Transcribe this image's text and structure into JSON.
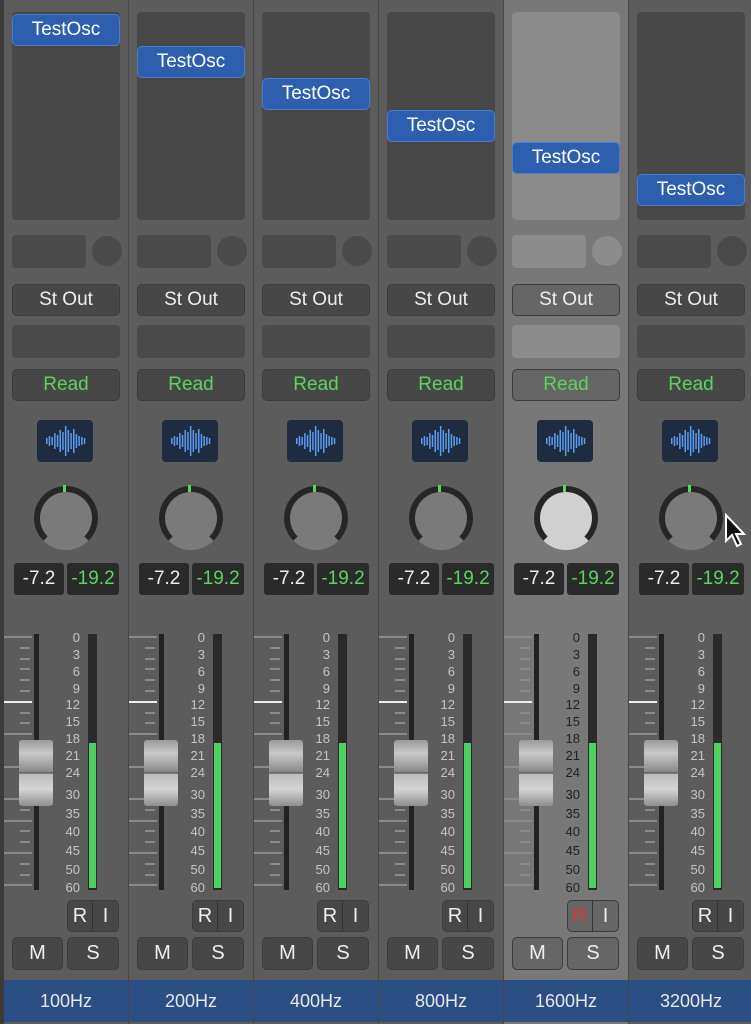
{
  "strips": [
    {
      "insert": "TestOsc",
      "output": "St Out",
      "automation": "Read",
      "volume": "-7.2",
      "peak": "-19.2",
      "record": "R",
      "input": "I",
      "mute": "M",
      "solo": "S",
      "name": "100Hz",
      "selected": false,
      "meter_db": -19.2
    },
    {
      "insert": "TestOsc",
      "output": "St Out",
      "automation": "Read",
      "volume": "-7.2",
      "peak": "-19.2",
      "record": "R",
      "input": "I",
      "mute": "M",
      "solo": "S",
      "name": "200Hz",
      "selected": false,
      "meter_db": -19.2
    },
    {
      "insert": "TestOsc",
      "output": "St Out",
      "automation": "Read",
      "volume": "-7.2",
      "peak": "-19.2",
      "record": "R",
      "input": "I",
      "mute": "M",
      "solo": "S",
      "name": "400Hz",
      "selected": false,
      "meter_db": -19.2
    },
    {
      "insert": "TestOsc",
      "output": "St Out",
      "automation": "Read",
      "volume": "-7.2",
      "peak": "-19.2",
      "record": "R",
      "input": "I",
      "mute": "M",
      "solo": "S",
      "name": "800Hz",
      "selected": false,
      "meter_db": -19.2
    },
    {
      "insert": "TestOsc",
      "output": "St Out",
      "automation": "Read",
      "volume": "-7.2",
      "peak": "-19.2",
      "record": "R",
      "input": "I",
      "mute": "M",
      "solo": "S",
      "name": "1600Hz",
      "selected": true,
      "record_armed": true,
      "meter_db": -19.2
    },
    {
      "insert": "TestOsc",
      "output": "St Out",
      "automation": "Read",
      "volume": "-7.2",
      "peak": "-19.2",
      "record": "R",
      "input": "I",
      "mute": "M",
      "solo": "S",
      "name": "3200Hz",
      "selected": false,
      "meter_db": -19.2
    }
  ],
  "meter_scale": [
    "0",
    "3",
    "6",
    "9",
    "12",
    "15",
    "18",
    "21",
    "24",
    "30",
    "35",
    "40",
    "45",
    "50",
    "60"
  ],
  "icons": {
    "plugin": "waveform-icon",
    "pan": "knob-icon",
    "cursor": "mouse-pointer-icon"
  },
  "colors": {
    "insert": "#2e5fae",
    "automation": "#5fd35f",
    "meter": "#4fd062",
    "name_bar": "#2b4f84",
    "record_armed": "#d83a3a"
  }
}
